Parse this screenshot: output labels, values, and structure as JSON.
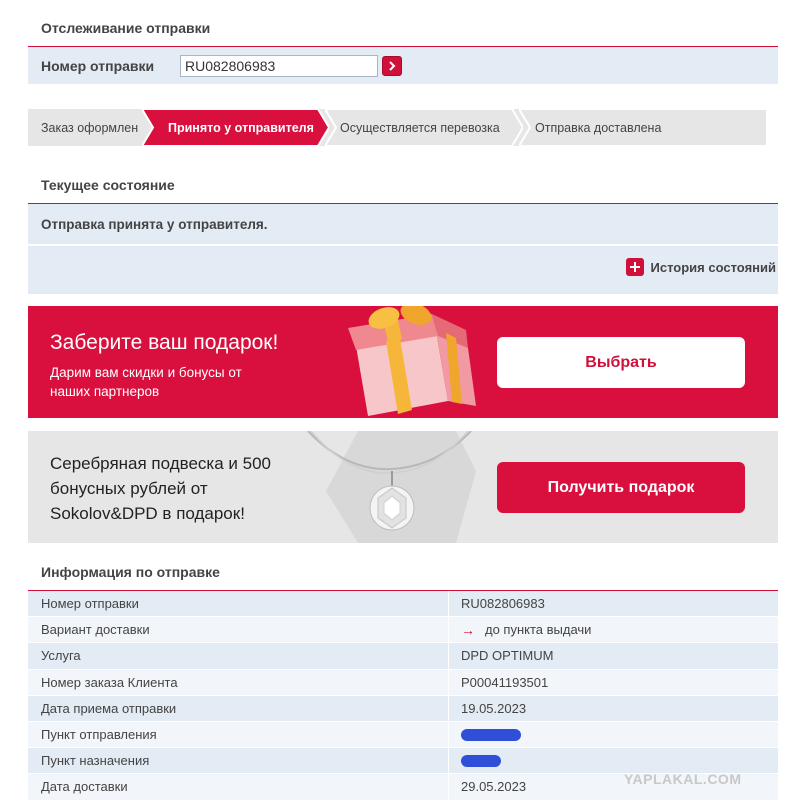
{
  "tracking": {
    "title": "Отслеживание отправки",
    "number_label": "Номер отправки",
    "number_value": "RU082806983",
    "go_icon": "chevron-right-icon"
  },
  "steps": [
    {
      "label": "Заказ оформлен",
      "state": "done"
    },
    {
      "label": "Принято у отправителя",
      "state": "active"
    },
    {
      "label": "Осуществляется перевозка",
      "state": "pending"
    },
    {
      "label": "Отправка доставлена",
      "state": "pending"
    }
  ],
  "current": {
    "title": "Текущее состояние",
    "status_text": "Отправка принята у отправителя.",
    "history_label": "История состояний"
  },
  "promo_gift": {
    "title": "Заберите ваш подарок!",
    "subtitle": "Дарим вам скидки и бонусы от наших партнеров",
    "button": "Выбрать"
  },
  "promo_pendant": {
    "text": "Серебряная подвеска и 500 бонусных рублей от Sokolov&DPD в подарок!",
    "button": "Получить подарок"
  },
  "info": {
    "title": "Информация по отправке",
    "rows": [
      {
        "label": "Номер отправки",
        "value": "RU082806983"
      },
      {
        "label": "Вариант доставки",
        "value": "до пункта выдачи"
      },
      {
        "label": "Услуга",
        "value": "DPD OPTIMUM"
      },
      {
        "label": "Номер заказа Клиента",
        "value": "P00041193501"
      },
      {
        "label": "Дата приема отправки",
        "value": "19.05.2023"
      },
      {
        "label": "Пункт отправления",
        "value": ""
      },
      {
        "label": "Пункт назначения",
        "value": ""
      },
      {
        "label": "Дата доставки",
        "value": "29.05.2023"
      }
    ]
  },
  "watermark": "YAPLAKAL.COM",
  "colors": {
    "accent": "#d90f3d",
    "row_blue": "#e3ebf4",
    "step_grey": "#e6e6e6"
  }
}
